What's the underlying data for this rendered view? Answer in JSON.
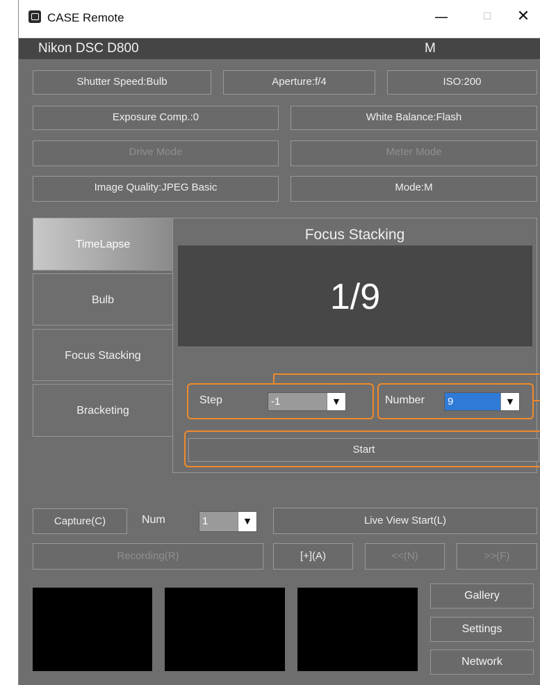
{
  "window": {
    "title": "CASE Remote",
    "min_glyph": "—",
    "max_glyph": "☐",
    "close_glyph": "✕"
  },
  "status": {
    "camera": "Nikon DSC D800",
    "mode": "M"
  },
  "settings": {
    "shutter": "Shutter Speed:Bulb",
    "aperture": "Aperture:f/4",
    "iso": "ISO:200",
    "exposure": "Exposure Comp.:0",
    "white_balance": "White Balance:Flash",
    "drive": "Drive Mode",
    "meter": "Meter Mode",
    "quality": "Image Quality:JPEG Basic",
    "mode": "Mode:M"
  },
  "tabs": [
    {
      "label": "TimeLapse",
      "active": true
    },
    {
      "label": "Bulb"
    },
    {
      "label": "Focus Stacking"
    },
    {
      "label": "Bracketing"
    }
  ],
  "panel": {
    "title": "Focus Stacking",
    "counter": "1/9",
    "step_label": "Step",
    "step_value": "-1",
    "number_label": "Number",
    "number_value": "9",
    "start": "Start",
    "arrow_glyph": "▼"
  },
  "controls": {
    "capture": "Capture(C)",
    "num_label": "Num",
    "num_value": "1",
    "live_view": "Live View Start(L)",
    "recording": "Recording(R)",
    "plus": "[+](A)",
    "prev": "<<(N)",
    "next": ">>(F)"
  },
  "side_buttons": {
    "gallery": "Gallery",
    "settings": "Settings",
    "network": "Network"
  },
  "colors": {
    "accent": "#f08a2a",
    "background": "#6e6e6e",
    "selected": "#2f7ad6"
  }
}
